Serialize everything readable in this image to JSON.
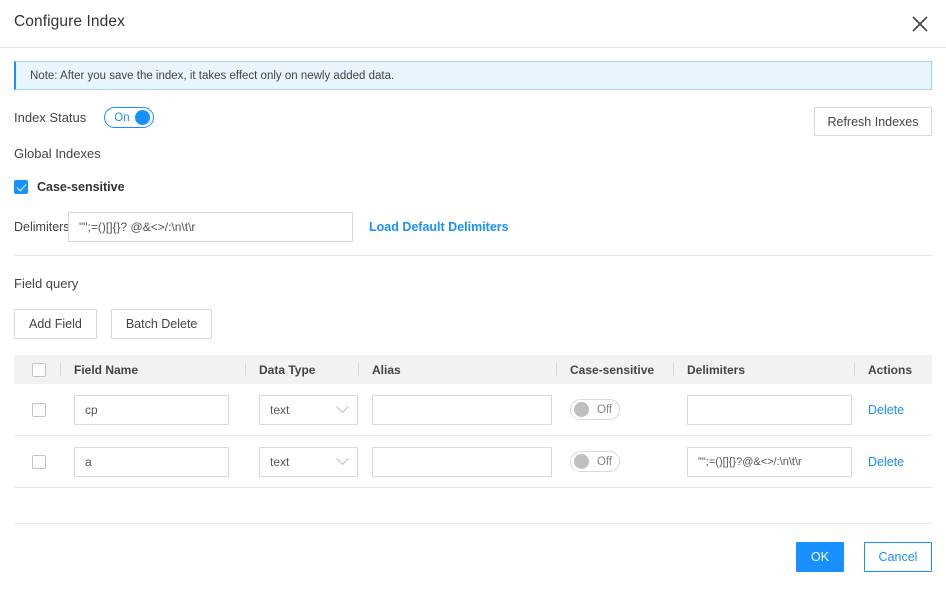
{
  "dialog": {
    "title": "Configure Index",
    "close_icon": "close-icon"
  },
  "note": {
    "text": "Note: After you save the index, it takes effect only on newly added data."
  },
  "index_status": {
    "label": "Index Status",
    "toggle_value": "On",
    "refresh_button": "Refresh Indexes"
  },
  "global_indexes": {
    "title": "Global Indexes",
    "case_sensitive_label": "Case-sensitive",
    "case_sensitive_checked": true,
    "delimiters_label": "Delimiters",
    "delimiters_value": "\"\";=()[]{}? @&<>/:\\n\\t\\r",
    "load_default_link": "Load Default Delimiters"
  },
  "field_query": {
    "title": "Field query",
    "add_field_button": "Add Field",
    "batch_delete_button": "Batch Delete",
    "columns": [
      "Field Name",
      "Data Type",
      "Alias",
      "Case-sensitive",
      "Delimiters",
      "Actions"
    ],
    "rows": [
      {
        "selected": false,
        "field_name": "cp",
        "data_type": "text",
        "alias": "",
        "case_sensitive": "Off",
        "delimiters": "",
        "action": "Delete"
      },
      {
        "selected": false,
        "field_name": "a",
        "data_type": "text",
        "alias": "",
        "case_sensitive": "Off",
        "delimiters": "\"\";=()[]{}?@&<>/:\\n\\t\\r",
        "action": "Delete"
      }
    ]
  },
  "footer": {
    "ok_label": "OK",
    "cancel_label": "Cancel"
  },
  "colors": {
    "accent": "#1890ff",
    "note_bg": "#e8f5fd",
    "note_border": "#9fd5f5",
    "header_row_bg": "#f2f2f5",
    "divider": "#e8e8e8"
  }
}
